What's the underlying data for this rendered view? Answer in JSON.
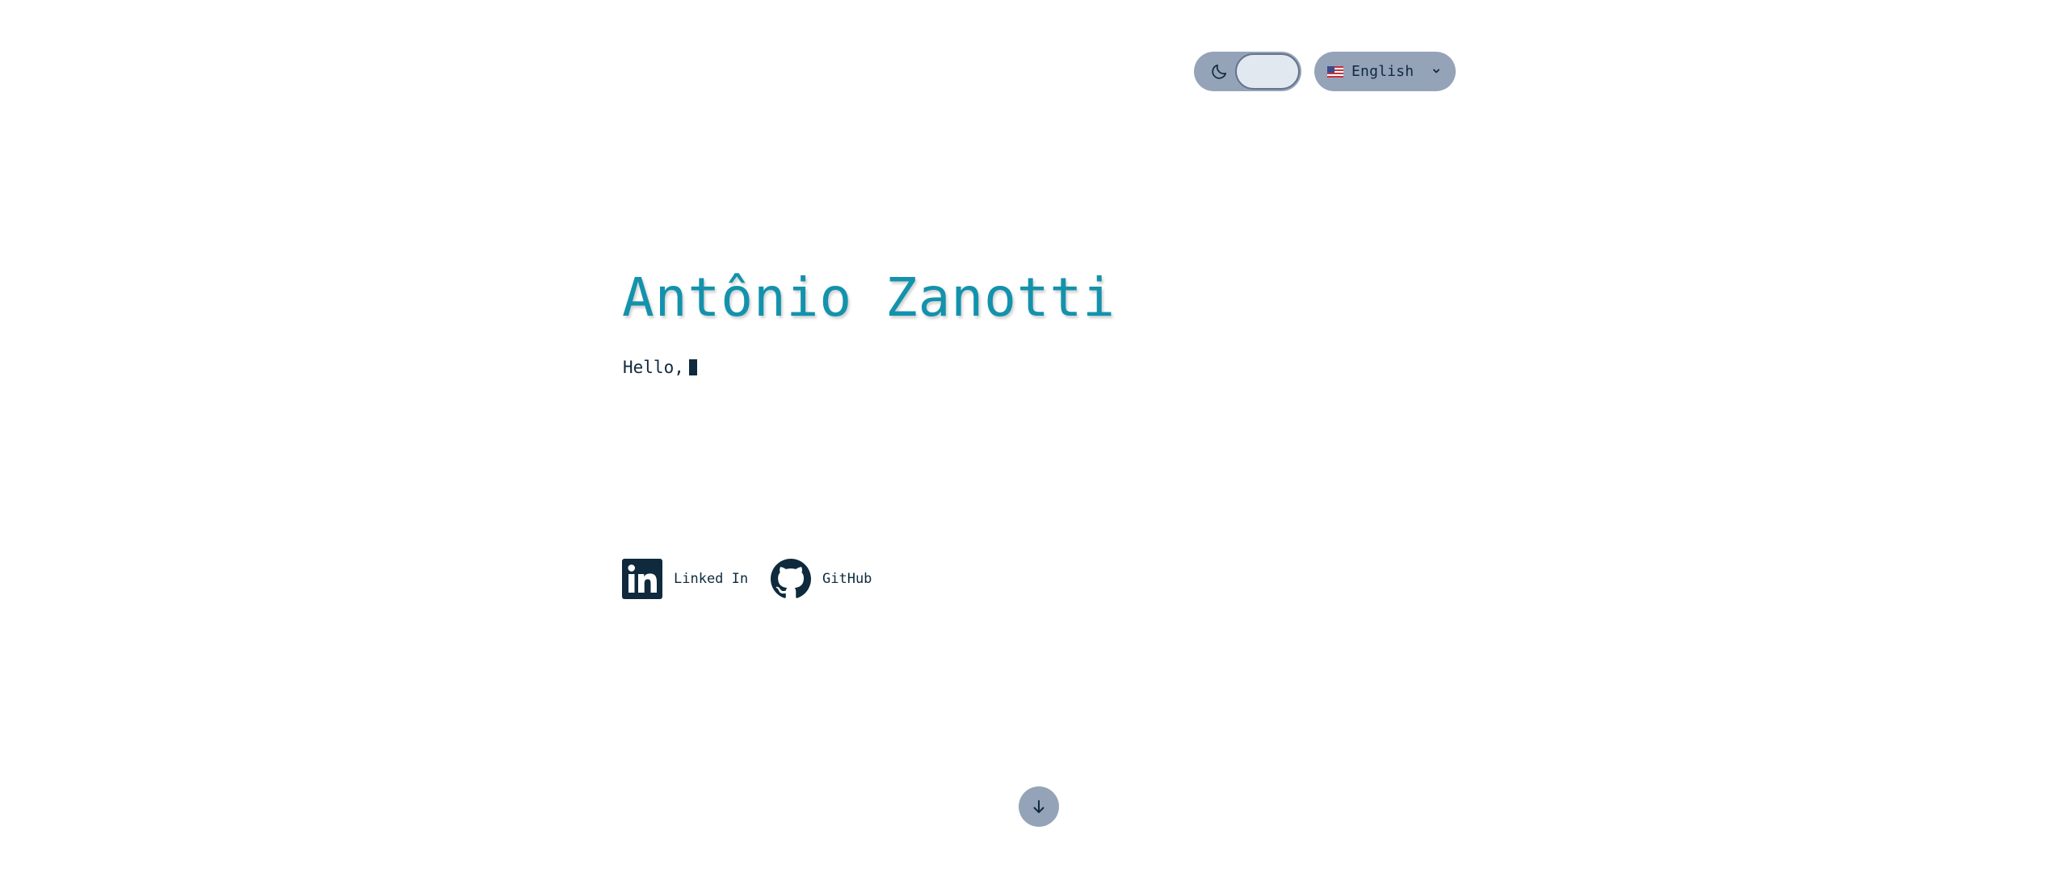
{
  "header": {
    "theme_toggle": {
      "icon": "moon-icon",
      "mode": "light"
    },
    "language": {
      "selected": "English",
      "flag": "us-flag-icon",
      "dropdown_icon": "chevron-down-icon"
    }
  },
  "hero": {
    "name": "Antônio Zanotti",
    "greeting": "Hello,"
  },
  "social": [
    {
      "label": "Linked In",
      "icon": "linkedin-icon"
    },
    {
      "label": "GitHub",
      "icon": "github-icon"
    }
  ],
  "scroll_button": {
    "icon": "arrow-down-icon"
  },
  "colors": {
    "accent": "#1392ac",
    "text": "#0f2a3d",
    "control_bg": "#94a3b8",
    "toggle_knob": "#e2e8f0"
  }
}
